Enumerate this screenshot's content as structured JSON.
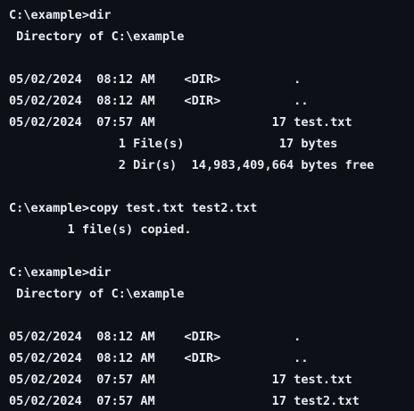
{
  "terminal": {
    "lines": [
      "C:\\example>dir",
      " Directory of C:\\example",
      "",
      "05/02/2024  08:12 AM    <DIR>          .",
      "05/02/2024  08:12 AM    <DIR>          ..",
      "05/02/2024  07:57 AM                17 test.txt",
      "               1 File(s)             17 bytes",
      "               2 Dir(s)  14,983,409,664 bytes free",
      "",
      "C:\\example>copy test.txt test2.txt",
      "        1 file(s) copied.",
      "",
      "C:\\example>dir",
      " Directory of C:\\example",
      "",
      "05/02/2024  08:12 AM    <DIR>          .",
      "05/02/2024  08:12 AM    <DIR>          ..",
      "05/02/2024  07:57 AM                17 test.txt",
      "05/02/2024  07:57 AM                17 test2.txt"
    ]
  }
}
